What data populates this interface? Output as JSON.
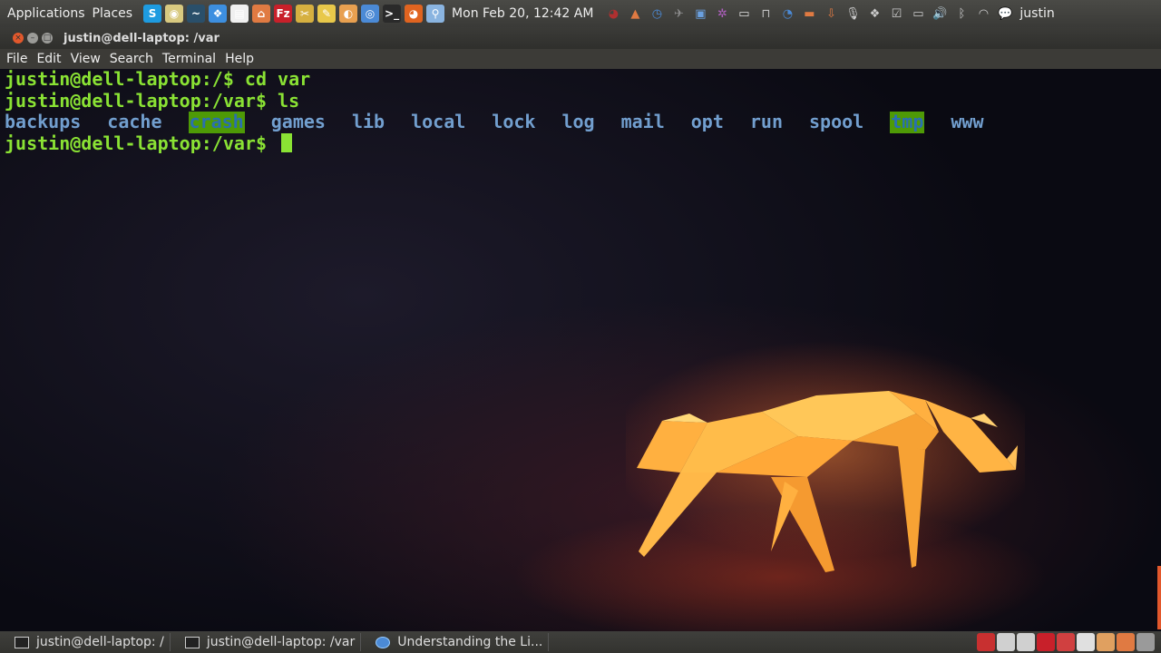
{
  "top_panel": {
    "applications_label": "Applications",
    "places_label": "Places",
    "launchers": [
      {
        "icon": "skype-icon",
        "glyph": "S",
        "color": "#1e9be0"
      },
      {
        "icon": "pidgin-icon",
        "glyph": "◉",
        "color": "#d8c980"
      },
      {
        "icon": "system-monitor-icon",
        "glyph": "~",
        "color": "#2a4f6a"
      },
      {
        "icon": "dropbox-icon",
        "glyph": "❖",
        "color": "#3d8fe0"
      },
      {
        "icon": "text-editor-icon",
        "glyph": "▤",
        "color": "#f0f0f0"
      },
      {
        "icon": "home-folder-icon",
        "glyph": "⌂",
        "color": "#e07a42"
      },
      {
        "icon": "filezilla-icon",
        "glyph": "Fz",
        "color": "#c8202a"
      },
      {
        "icon": "tools-icon",
        "glyph": "✂",
        "color": "#d6b040"
      },
      {
        "icon": "notes-icon",
        "glyph": "✎",
        "color": "#e8c84a"
      },
      {
        "icon": "image-viewer-icon",
        "glyph": "◐",
        "color": "#e8a050"
      },
      {
        "icon": "chromium-icon",
        "glyph": "◎",
        "color": "#4b8ad6"
      },
      {
        "icon": "terminal-icon",
        "glyph": ">_",
        "color": "#2a2a2a"
      },
      {
        "icon": "firefox-icon",
        "glyph": "◕",
        "color": "#e06420"
      },
      {
        "icon": "search-icon",
        "glyph": "⚲",
        "color": "#8ab4e0"
      }
    ],
    "clock": "Mon Feb 20, 12:42 AM",
    "tray_icons": [
      {
        "icon": "weather-icon",
        "glyph": "◕",
        "color": "#b03030"
      },
      {
        "icon": "update-icon",
        "glyph": "▲",
        "color": "#e07a42"
      },
      {
        "icon": "clock-icon",
        "glyph": "◷",
        "color": "#4b8ad6"
      },
      {
        "icon": "sync-icon",
        "glyph": "✈",
        "color": "#8a8a8a"
      },
      {
        "icon": "screenshot-icon",
        "glyph": "▣",
        "color": "#6aa0e0"
      },
      {
        "icon": "settings-icon",
        "glyph": "✲",
        "color": "#b060c0"
      },
      {
        "icon": "document-icon",
        "glyph": "▭",
        "color": "#e0e0e0"
      },
      {
        "icon": "network-share-icon",
        "glyph": "⊓",
        "color": "#c0c0c0"
      },
      {
        "icon": "bluetooth-share-icon",
        "glyph": "◔",
        "color": "#4b8ad6"
      },
      {
        "icon": "folder-icon",
        "glyph": "▬",
        "color": "#e07a42"
      },
      {
        "icon": "downloads-icon",
        "glyph": "⇩",
        "color": "#e07a42"
      },
      {
        "icon": "microphone-icon",
        "glyph": "🎙",
        "color": "#cccccc"
      },
      {
        "icon": "dropbox-tray-icon",
        "glyph": "❖",
        "color": "#cccccc"
      },
      {
        "icon": "checklist-icon",
        "glyph": "☑",
        "color": "#cccccc"
      },
      {
        "icon": "battery-icon",
        "glyph": "▭",
        "color": "#cccccc"
      },
      {
        "icon": "volume-icon",
        "glyph": "🔊",
        "color": "#cccccc"
      },
      {
        "icon": "bluetooth-icon",
        "glyph": "ᛒ",
        "color": "#cccccc"
      },
      {
        "icon": "wifi-icon",
        "glyph": "◠",
        "color": "#cccccc"
      },
      {
        "icon": "chat-icon",
        "glyph": "💬",
        "color": "#cccccc"
      }
    ],
    "user": "justin"
  },
  "window": {
    "title": "justin@dell-laptop: /var"
  },
  "menubar": {
    "items": [
      "File",
      "Edit",
      "View",
      "Search",
      "Terminal",
      "Help"
    ]
  },
  "terminal": {
    "lines": [
      "justin@dell-laptop:/$ cd var",
      "justin@dell-laptop:/var$ ls"
    ],
    "ls_output": [
      {
        "name": "backups",
        "highlight": false
      },
      {
        "name": "cache",
        "highlight": false
      },
      {
        "name": "crash",
        "highlight": true
      },
      {
        "name": "games",
        "highlight": false
      },
      {
        "name": "lib",
        "highlight": false
      },
      {
        "name": "local",
        "highlight": false
      },
      {
        "name": "lock",
        "highlight": false
      },
      {
        "name": "log",
        "highlight": false
      },
      {
        "name": "mail",
        "highlight": false
      },
      {
        "name": "opt",
        "highlight": false
      },
      {
        "name": "run",
        "highlight": false
      },
      {
        "name": "spool",
        "highlight": false
      },
      {
        "name": "tmp",
        "highlight": true
      },
      {
        "name": "www",
        "highlight": false
      }
    ],
    "prompt": "justin@dell-laptop:/var$ ",
    "colors": {
      "prompt": "#8ae234",
      "dir": "#729fcf",
      "highlight_bg": "#4e9a06"
    }
  },
  "taskbar": {
    "tasks": [
      {
        "label": "justin@dell-laptop: /",
        "icon": "terminal-icon"
      },
      {
        "label": "justin@dell-laptop: /var",
        "icon": "terminal-icon"
      },
      {
        "label": "Understanding the Li...",
        "icon": "chromium-icon"
      }
    ],
    "tray_icons": [
      {
        "icon": "stop-icon",
        "color": "#c83030"
      },
      {
        "icon": "download-manager-icon",
        "color": "#d0d0d0"
      },
      {
        "icon": "gear-icon",
        "color": "#d0d0d0"
      },
      {
        "icon": "filezilla-icon",
        "color": "#c8202a"
      },
      {
        "icon": "editor-icon",
        "color": "#d04040"
      },
      {
        "icon": "document-icon",
        "color": "#e0e0e0"
      },
      {
        "icon": "image-icon",
        "color": "#e0a060"
      },
      {
        "icon": "folder-icon",
        "color": "#e07a42"
      },
      {
        "icon": "show-desktop-icon",
        "color": "#9a9a9a"
      }
    ]
  }
}
